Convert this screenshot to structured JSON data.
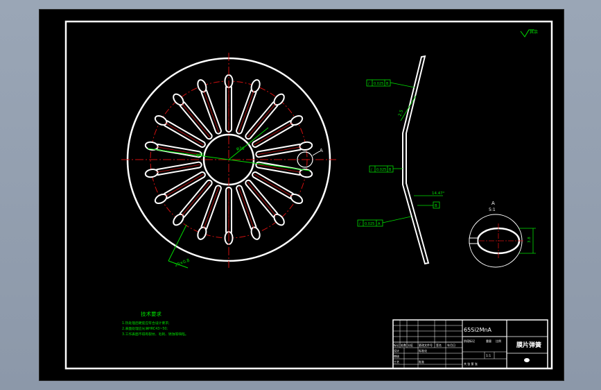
{
  "colors": {
    "background": "#000000",
    "frame": "#ffffff",
    "centerline": "#d01010",
    "dimension": "#00e000",
    "part": "#ffffff"
  },
  "top_right_symbol": "其余",
  "front_view": {
    "detail_ref": "A",
    "hub_label": "φ36",
    "outer_label": "φ80",
    "bottom_dim": "20×0.8"
  },
  "section_view": {
    "tolerance_1": "0.025",
    "datum_1": "B",
    "tolerance_2": "0.025",
    "datum_2": "B",
    "tolerance_3": "0.025",
    "datum_3": "A",
    "angle_label": "14.47°",
    "datum_box": "B",
    "slot_label": "2.5"
  },
  "detail_view": {
    "title": "A",
    "scale": "5:1",
    "dim": "3.8"
  },
  "notes": {
    "title": "技术要求",
    "lines": [
      "1.热处理后硬度应符合设计要求;",
      "2.表面处理应光滑HRC43~50;",
      "3.工作表面不得有裂纹、毛刺、锈蚀等缺陷。"
    ]
  },
  "title_block": {
    "material": "65Si2MnA",
    "part_name": "膜片弹簧",
    "header_cells": [
      "标记",
      "处数",
      "分区",
      "更改文件号",
      "签名",
      "年月日"
    ],
    "row_designer": "设计",
    "row_standard": "标准化",
    "row_check": "审核",
    "row_process": "工艺",
    "row_approve": "批准",
    "stage_label": "阶段标记",
    "weight_label": "重量",
    "scale_label": "比例",
    "scale_value": "1:1",
    "sheet_label": "共 张 第 张"
  }
}
